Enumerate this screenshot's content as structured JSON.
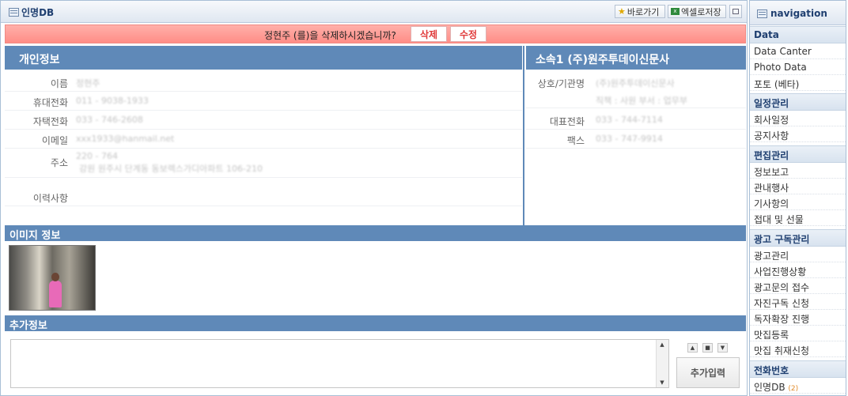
{
  "window": {
    "title": "인명DB",
    "shortcut_label": "바로가기",
    "excel_label": "엑셀로저장"
  },
  "confirm": {
    "message": "정현주 (를)을 삭제하시겠습니까?",
    "delete_label": "삭제",
    "edit_label": "수정"
  },
  "personal": {
    "heading": "개인정보",
    "fields": [
      {
        "label": "이름",
        "value": "정현주"
      },
      {
        "label": "휴대전화",
        "value": "011 - 9038-1933"
      },
      {
        "label": "자택전화",
        "value": "033 - 746-2608"
      },
      {
        "label": "이메일",
        "value": "xxx1933@hanmail.net"
      },
      {
        "label": "주소",
        "value": "220 - 764",
        "value2": "강원 원주시 단계동 동보렉스가디아파트 106-210"
      },
      {
        "label": "이력사항",
        "value": ""
      }
    ]
  },
  "company": {
    "heading": "소속1 (주)원주투데이신문사",
    "fields": [
      {
        "label": "상호/기관명",
        "value": "(주)원주투데이신문사",
        "value2": "직책 : 사원   부서 : 업무부"
      },
      {
        "label": "대표전화",
        "value": "033 - 744-7114"
      },
      {
        "label": "팩스",
        "value": "033 - 747-9914"
      }
    ]
  },
  "image_section": {
    "heading": "이미지 정보"
  },
  "extra_section": {
    "heading": "추가정보",
    "memo_value": "",
    "add_button_label": "추가입력"
  },
  "navigation": {
    "title": "navigation",
    "groups": [
      {
        "heading": "Data",
        "items": [
          {
            "label": "Data Canter"
          },
          {
            "label": "Photo Data"
          },
          {
            "label": "포토 (베타)"
          }
        ]
      },
      {
        "heading": "일정관리",
        "items": [
          {
            "label": "회사일정"
          },
          {
            "label": "공지사항"
          }
        ]
      },
      {
        "heading": "편집관리",
        "items": [
          {
            "label": "정보보고"
          },
          {
            "label": "관내행사"
          },
          {
            "label": "기사항의"
          },
          {
            "label": "접대 및 선물"
          }
        ]
      },
      {
        "heading": "광고 구독관리",
        "items": [
          {
            "label": "광고관리"
          },
          {
            "label": "사업진행상황"
          },
          {
            "label": "광고문의 접수"
          },
          {
            "label": "자진구독 신청"
          },
          {
            "label": "독자확장 진행"
          },
          {
            "label": "맛집등록"
          },
          {
            "label": "맛집 취재신청"
          }
        ]
      },
      {
        "heading": "전화번호",
        "items": [
          {
            "label": "인명DB",
            "count": "(2)"
          }
        ]
      }
    ]
  },
  "colors": {
    "section_header": "#5f89b8",
    "confirm_bar": "#ff9c95",
    "delete_text": "#e03a3a",
    "nav_text": "#1f3f70"
  }
}
